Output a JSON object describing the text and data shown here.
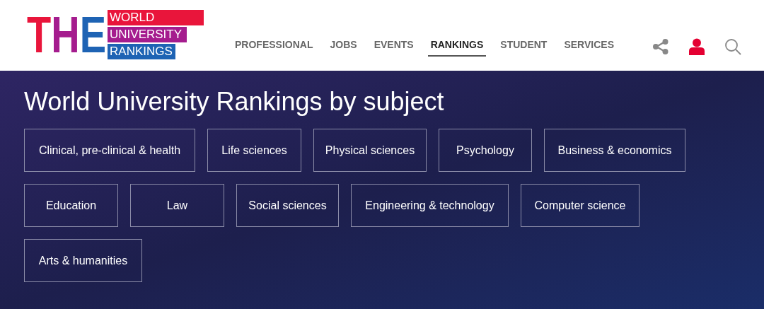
{
  "logo": {
    "letters": [
      "T",
      "H",
      "E"
    ],
    "lines": [
      "WORLD",
      "UNIVERSITY",
      "RANKINGS"
    ]
  },
  "nav": [
    {
      "label": "PROFESSIONAL",
      "selected": false
    },
    {
      "label": "JOBS",
      "selected": false
    },
    {
      "label": "EVENTS",
      "selected": false
    },
    {
      "label": "RANKINGS",
      "selected": true
    },
    {
      "label": "STUDENT",
      "selected": false
    },
    {
      "label": "SERVICES",
      "selected": false
    }
  ],
  "title": "World University Rankings by subject",
  "subject_rows": [
    [
      "Clinical, pre-clinical & health",
      "Life sciences",
      "Physical sciences",
      "Psychology",
      "Business & economics"
    ],
    [
      "Education",
      "Law",
      "Social sciences",
      "Engineering & technology",
      "Computer science"
    ],
    [
      "Arts & humanities"
    ]
  ]
}
